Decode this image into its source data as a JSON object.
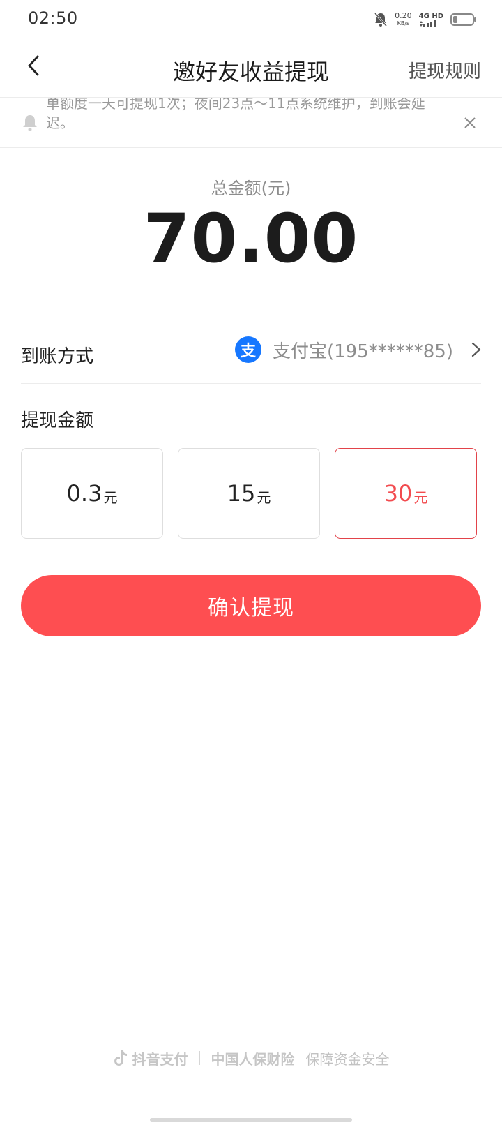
{
  "status_bar": {
    "time": "02:50",
    "speed_value": "0.20",
    "speed_unit": "KB/s",
    "network": "4G HD"
  },
  "header": {
    "title": "邀好友收益提现",
    "rules_label": "提现规则"
  },
  "notice": {
    "text": "单额度一天可提现1次；夜间23点～11点系统维护，到账会延迟。"
  },
  "total": {
    "label": "总金额(元)",
    "value": "70.00"
  },
  "method": {
    "label": "到账方式",
    "icon_text": "支",
    "value": "支付宝(195******85)"
  },
  "amount": {
    "label": "提现金额",
    "options": [
      {
        "num": "0.3",
        "unit": "元"
      },
      {
        "num": "15",
        "unit": "元"
      },
      {
        "num": "30",
        "unit": "元"
      }
    ]
  },
  "confirm_label": "确认提现",
  "footer": {
    "brand": "抖音支付",
    "insurer": "中国人保财险",
    "guarantee": "保障资金安全"
  },
  "colors": {
    "accent": "#fe4e51",
    "selected_text": "#f24b4f",
    "alipay": "#1677ff"
  }
}
